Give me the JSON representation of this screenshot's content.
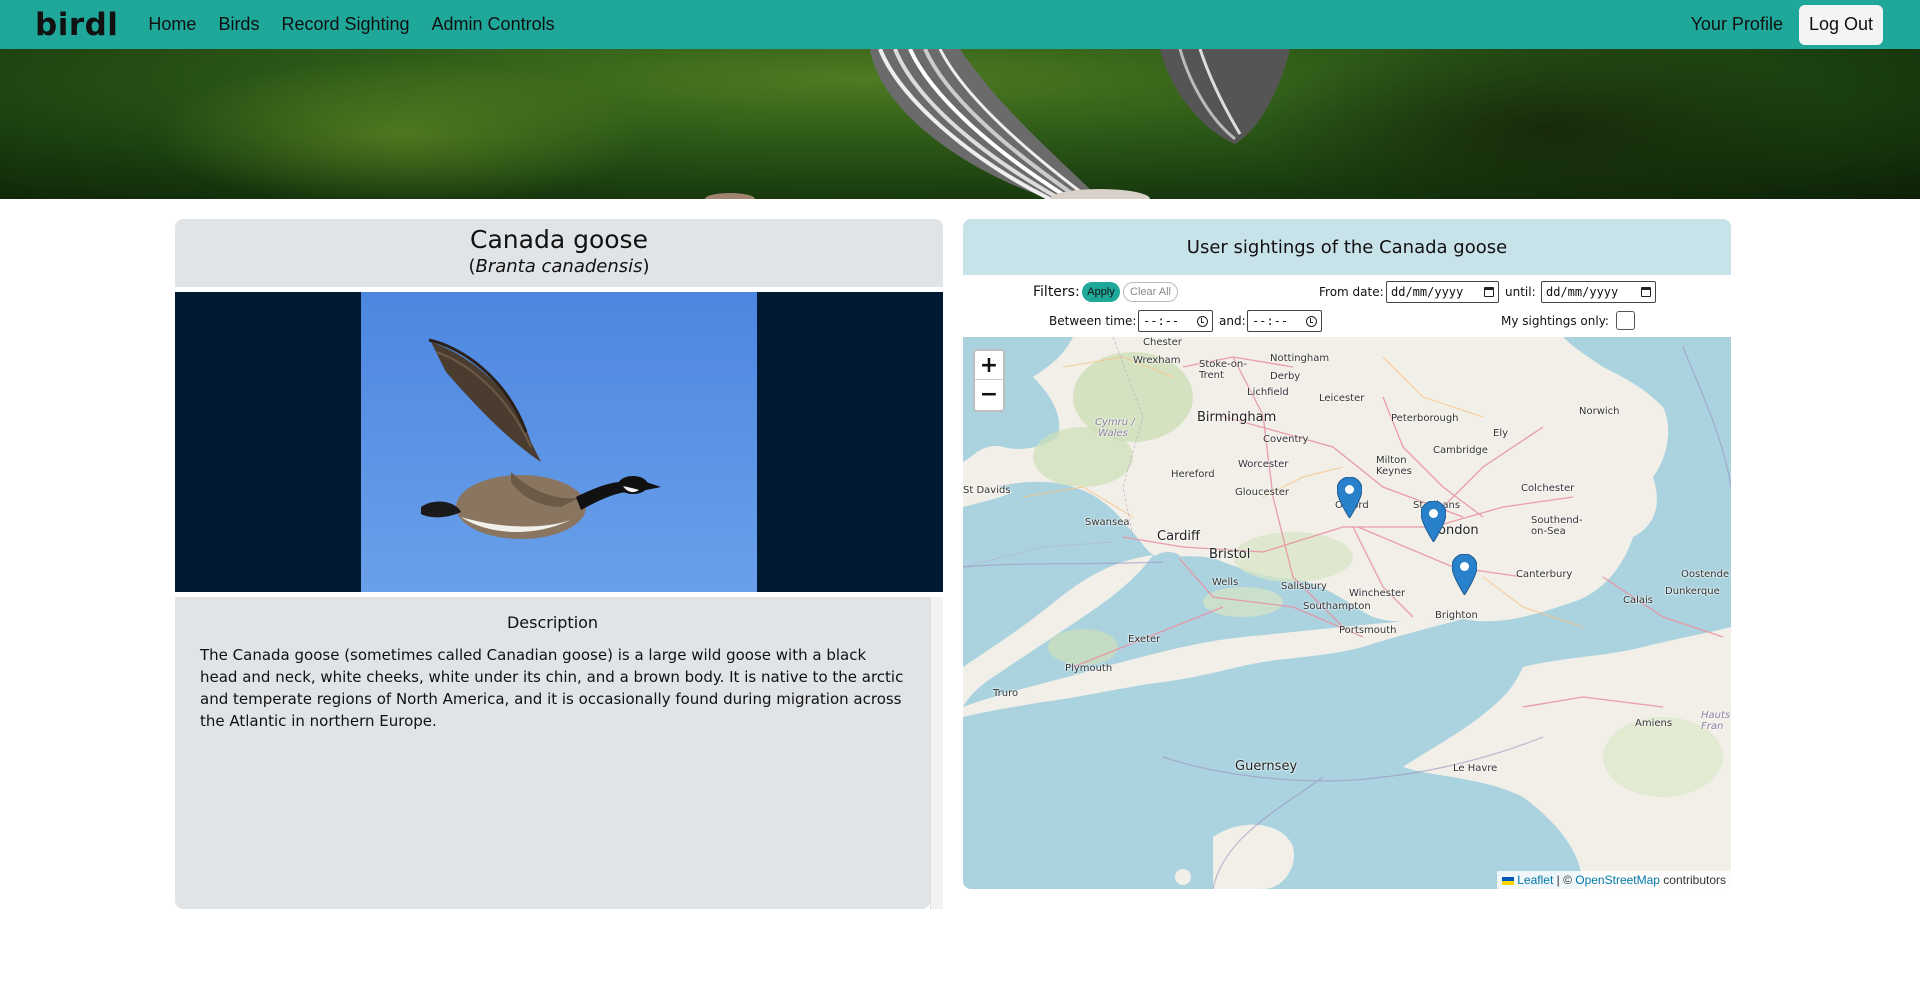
{
  "nav": {
    "brand": "birdl",
    "links": [
      "Home",
      "Birds",
      "Record Sighting",
      "Admin Controls"
    ],
    "profile": "Your Profile",
    "logout": "Log Out"
  },
  "bird": {
    "name": "Canada goose",
    "latin": "Branta canadensis",
    "description_title": "Description",
    "description": "The Canada goose (sometimes called Canadian goose) is a large wild goose with a black head and neck, white cheeks, white under its chin, and a brown body. It is native to the arctic and temperate regions of North America, and it is occasionally found during migration across the Atlantic in northern Europe."
  },
  "sightings": {
    "title": "User sightings of the Canada goose",
    "filters_label": "Filters:",
    "apply": "Apply",
    "clear": "Clear All",
    "from_date_label": "From date:",
    "from_date_placeholder": "dd/mm/yyyy",
    "until_label": "until:",
    "until_placeholder": "dd/mm/yyyy",
    "between_time_label": "Between time:",
    "time_from_placeholder": "--:--",
    "and_label": "and:",
    "time_to_placeholder": "--:--",
    "my_sightings_label": "My sightings only:",
    "my_sightings_checked": false
  },
  "map": {
    "zoom_in": "+",
    "zoom_out": "−",
    "attribution_leaflet": "Leaflet",
    "attribution_sep": " | © ",
    "attribution_osm": "OpenStreetMap",
    "attribution_tail": " contributors",
    "places": [
      "Chester",
      "Wrexham",
      "Stoke-on-Trent",
      "Nottingham",
      "Derby",
      "Lichfield",
      "Leicester",
      "Birmingham",
      "Peterborough",
      "Norwich",
      "Cymru / Wales",
      "Coventry",
      "Ely",
      "Cambridge",
      "Hereford",
      "Worcester",
      "Milton Keynes",
      "St Davids",
      "Gloucester",
      "Oxford",
      "St Albans",
      "Colchester",
      "Swansea",
      "London",
      "Southend-on-Sea",
      "Cardiff",
      "Bristol",
      "Canterbury",
      "Oostende",
      "Wells",
      "Salisbury",
      "Winchester",
      "Dunkerque",
      "Southampton",
      "Calais",
      "Brighton",
      "Portsmouth",
      "Exeter",
      "Plymouth",
      "Truro",
      "Amiens",
      "Hauts-de-France",
      "Guernsey",
      "Le Havre"
    ],
    "marker_color": "#2a81cb"
  },
  "colors": {
    "navbar": "#1fa89a",
    "title_card": "#e1e4e7",
    "map_header": "#c8e2ea",
    "sea": "#aad3df",
    "land": "#f2efe9"
  }
}
